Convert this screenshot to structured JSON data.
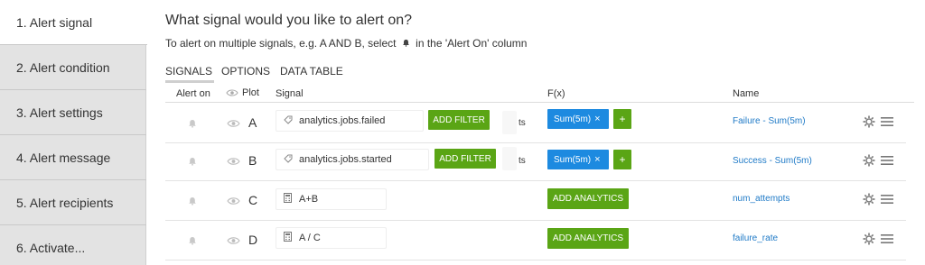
{
  "steps": [
    {
      "label": "1.  Alert signal",
      "active": true
    },
    {
      "label": "2.  Alert condition"
    },
    {
      "label": "3.  Alert settings"
    },
    {
      "label": "4.  Alert message"
    },
    {
      "label": "5.  Alert recipients"
    },
    {
      "label": "6.  Activate..."
    }
  ],
  "heading": "What signal would you like to alert on?",
  "subheading": {
    "before": "To alert on multiple signals, e.g. A AND B, select",
    "after": "in the 'Alert On' column"
  },
  "tabs": [
    "SIGNALS",
    "OPTIONS",
    "DATA TABLE"
  ],
  "columns": {
    "alert_on": "Alert on",
    "plot": "Plot",
    "signal": "Signal",
    "fx": "F(x)",
    "name": "Name"
  },
  "rows": [
    {
      "letter": "A",
      "signal": "analytics.jobs.failed",
      "add_filter": "ADD FILTER",
      "ts": "ts",
      "fx": "Sum(5m)",
      "plus": "+",
      "name": "Failure - Sum(5m)"
    },
    {
      "letter": "B",
      "signal": "analytics.jobs.started",
      "add_filter": "ADD FILTER",
      "ts": "ts",
      "fx": "Sum(5m)",
      "plus": "+",
      "name": "Success - Sum(5m)"
    },
    {
      "letter": "C",
      "signal": "A+B",
      "add_analytics": "ADD ANALYTICS",
      "name": "num_attempts"
    },
    {
      "letter": "D",
      "signal": "A / C",
      "add_analytics": "ADD ANALYTICS",
      "name": "failure_rate"
    }
  ],
  "colors": {
    "accent_green": "#5aa515",
    "accent_blue": "#1d8ae0",
    "link": "#1f7ac7",
    "sidebar": "#e3e3e3"
  }
}
